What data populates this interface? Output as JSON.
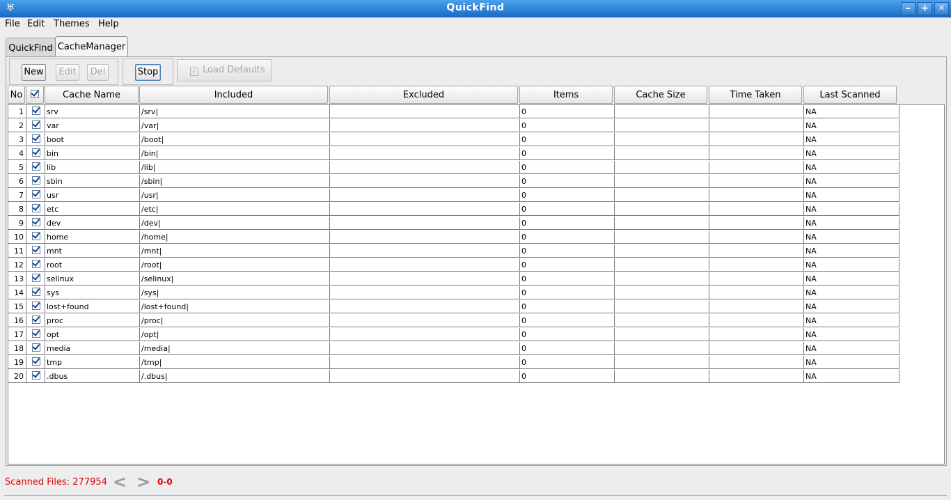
{
  "window": {
    "title": "QuickFind",
    "minimize": "–",
    "maximize": "+",
    "close": "✕",
    "app_icon": "♅"
  },
  "menu": [
    "File",
    "Edit",
    "Themes",
    "Help"
  ],
  "tabs": [
    {
      "label": "QuickFind",
      "active": false
    },
    {
      "label": "CacheManager",
      "active": true
    }
  ],
  "toolbar": {
    "new_label": "New",
    "edit_label": "Edit",
    "del_label": "Del",
    "stop_label": "Stop",
    "load_defaults_label": "Load Defaults"
  },
  "table": {
    "columns": [
      "No",
      "",
      "Cache Name",
      "Included",
      "Excluded",
      "Items",
      "Cache Size",
      "Time Taken",
      "Last Scanned"
    ],
    "rows": [
      {
        "no": "1",
        "name": "srv",
        "included": "/srv|",
        "excluded": "",
        "items": "0",
        "size": "",
        "time": "",
        "last": "NA"
      },
      {
        "no": "2",
        "name": "var",
        "included": "/var|",
        "excluded": "",
        "items": "0",
        "size": "",
        "time": "",
        "last": "NA"
      },
      {
        "no": "3",
        "name": "boot",
        "included": "/boot|",
        "excluded": "",
        "items": "0",
        "size": "",
        "time": "",
        "last": "NA"
      },
      {
        "no": "4",
        "name": "bin",
        "included": "/bin|",
        "excluded": "",
        "items": "0",
        "size": "",
        "time": "",
        "last": "NA"
      },
      {
        "no": "5",
        "name": "lib",
        "included": "/lib|",
        "excluded": "",
        "items": "0",
        "size": "",
        "time": "",
        "last": "NA"
      },
      {
        "no": "6",
        "name": "sbin",
        "included": "/sbin|",
        "excluded": "",
        "items": "0",
        "size": "",
        "time": "",
        "last": "NA"
      },
      {
        "no": "7",
        "name": "usr",
        "included": "/usr|",
        "excluded": "",
        "items": "0",
        "size": "",
        "time": "",
        "last": "NA"
      },
      {
        "no": "8",
        "name": "etc",
        "included": "/etc|",
        "excluded": "",
        "items": "0",
        "size": "",
        "time": "",
        "last": "NA"
      },
      {
        "no": "9",
        "name": "dev",
        "included": "/dev|",
        "excluded": "",
        "items": "0",
        "size": "",
        "time": "",
        "last": "NA"
      },
      {
        "no": "10",
        "name": "home",
        "included": "/home|",
        "excluded": "",
        "items": "0",
        "size": "",
        "time": "",
        "last": "NA"
      },
      {
        "no": "11",
        "name": "mnt",
        "included": "/mnt|",
        "excluded": "",
        "items": "0",
        "size": "",
        "time": "",
        "last": "NA"
      },
      {
        "no": "12",
        "name": "root",
        "included": "/root|",
        "excluded": "",
        "items": "0",
        "size": "",
        "time": "",
        "last": "NA"
      },
      {
        "no": "13",
        "name": "selinux",
        "included": "/selinux|",
        "excluded": "",
        "items": "0",
        "size": "",
        "time": "",
        "last": "NA"
      },
      {
        "no": "14",
        "name": "sys",
        "included": "/sys|",
        "excluded": "",
        "items": "0",
        "size": "",
        "time": "",
        "last": "NA"
      },
      {
        "no": "15",
        "name": "lost+found",
        "included": "/lost+found|",
        "excluded": "",
        "items": "0",
        "size": "",
        "time": "",
        "last": "NA"
      },
      {
        "no": "16",
        "name": "proc",
        "included": "/proc|",
        "excluded": "",
        "items": "0",
        "size": "",
        "time": "",
        "last": "NA"
      },
      {
        "no": "17",
        "name": "opt",
        "included": "/opt|",
        "excluded": "",
        "items": "0",
        "size": "",
        "time": "",
        "last": "NA"
      },
      {
        "no": "18",
        "name": "media",
        "included": "/media|",
        "excluded": "",
        "items": "0",
        "size": "",
        "time": "",
        "last": "NA"
      },
      {
        "no": "19",
        "name": "tmp",
        "included": "/tmp|",
        "excluded": "",
        "items": "0",
        "size": "",
        "time": "",
        "last": "NA"
      },
      {
        "no": "20",
        "name": ".dbus",
        "included": "/.dbus|",
        "excluded": "",
        "items": "0",
        "size": "",
        "time": "",
        "last": "NA"
      }
    ]
  },
  "status": {
    "scanned_label": "Scanned Files:",
    "scanned_count": "277954",
    "prev": "<",
    "next": ">",
    "range": "0-0"
  },
  "colors": {
    "titlebar": "#2d84da",
    "status_text": "#e00000",
    "check": "#1d3f82"
  }
}
